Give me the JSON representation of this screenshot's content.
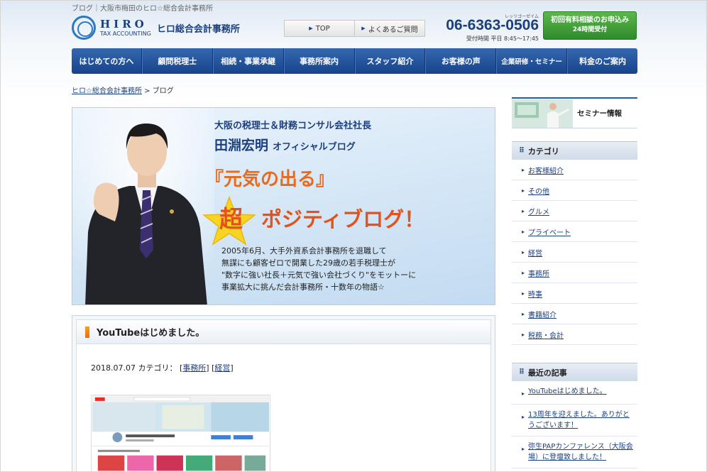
{
  "header": {
    "tagline": "ブログ｜大阪市梅田のヒロ☆総合会計事務所",
    "logo_main": "HIRO",
    "logo_sub": "TAX ACCOUNTING",
    "logo_jp": "ヒロ総合会計事務所",
    "links": [
      {
        "label": "TOP"
      },
      {
        "label": "よくあるご質問"
      }
    ],
    "phone_ruby": "レッツゴーゼイム",
    "phone": "06-6363-0506",
    "phone_hours": "受付時間 平日 8:45〜17:45",
    "cta_line1": "初回有料相談のお申込み",
    "cta_line2": "24時間受付",
    "cta_color": "#3b9a34"
  },
  "nav": [
    {
      "label": "はじめての方へ"
    },
    {
      "label": "顧問税理士"
    },
    {
      "label": "相続・事業承継"
    },
    {
      "label": "事務所案内"
    },
    {
      "label": "スタッフ紹介"
    },
    {
      "label": "お客様の声"
    },
    {
      "label": "企業研修・セミナー"
    },
    {
      "label": "料金のご案内"
    }
  ],
  "breadcrumb": {
    "home": "ヒロ☆総合会計事務所",
    "separator": ">",
    "current": "ブログ"
  },
  "hero": {
    "subtitle": "大阪の税理士＆財務コンサル会社社長",
    "name": "田淵宏明",
    "name_suffix": "オフィシャルブログ",
    "genki": "『元気の出る』",
    "cho": "超",
    "positive": "ポジティブログ！",
    "desc": [
      "2005年6月、大手外資系会計事務所を退職して",
      "無謀にも顧客ゼロで開業した29歳の若手税理士が",
      "\"数字に強い社長＋元気で強い会社づくり\"をモットーに",
      "事業拡大に挑んだ会計事務所・十数年の物語☆"
    ]
  },
  "article": {
    "title": "YouTubeはじめました。",
    "date": "2018.07.07",
    "category_label": "カテゴリ：",
    "categories": [
      "事務所",
      "経営"
    ]
  },
  "sidebar": {
    "seminar_label": "セミナー情報",
    "categories_title": "カテゴリ",
    "categories": [
      "お客様紹介",
      "その他",
      "グルメ",
      "プライベート",
      "経営",
      "事務所",
      "時事",
      "書籍紹介",
      "税務・会計"
    ],
    "recent_title": "最近の記事",
    "recent": [
      "YouTubeはじめました。",
      "13周年を迎えました。ありがとうございます！",
      "弥生PAPカンファレンス（大阪会場）に登壇致しました！"
    ]
  }
}
